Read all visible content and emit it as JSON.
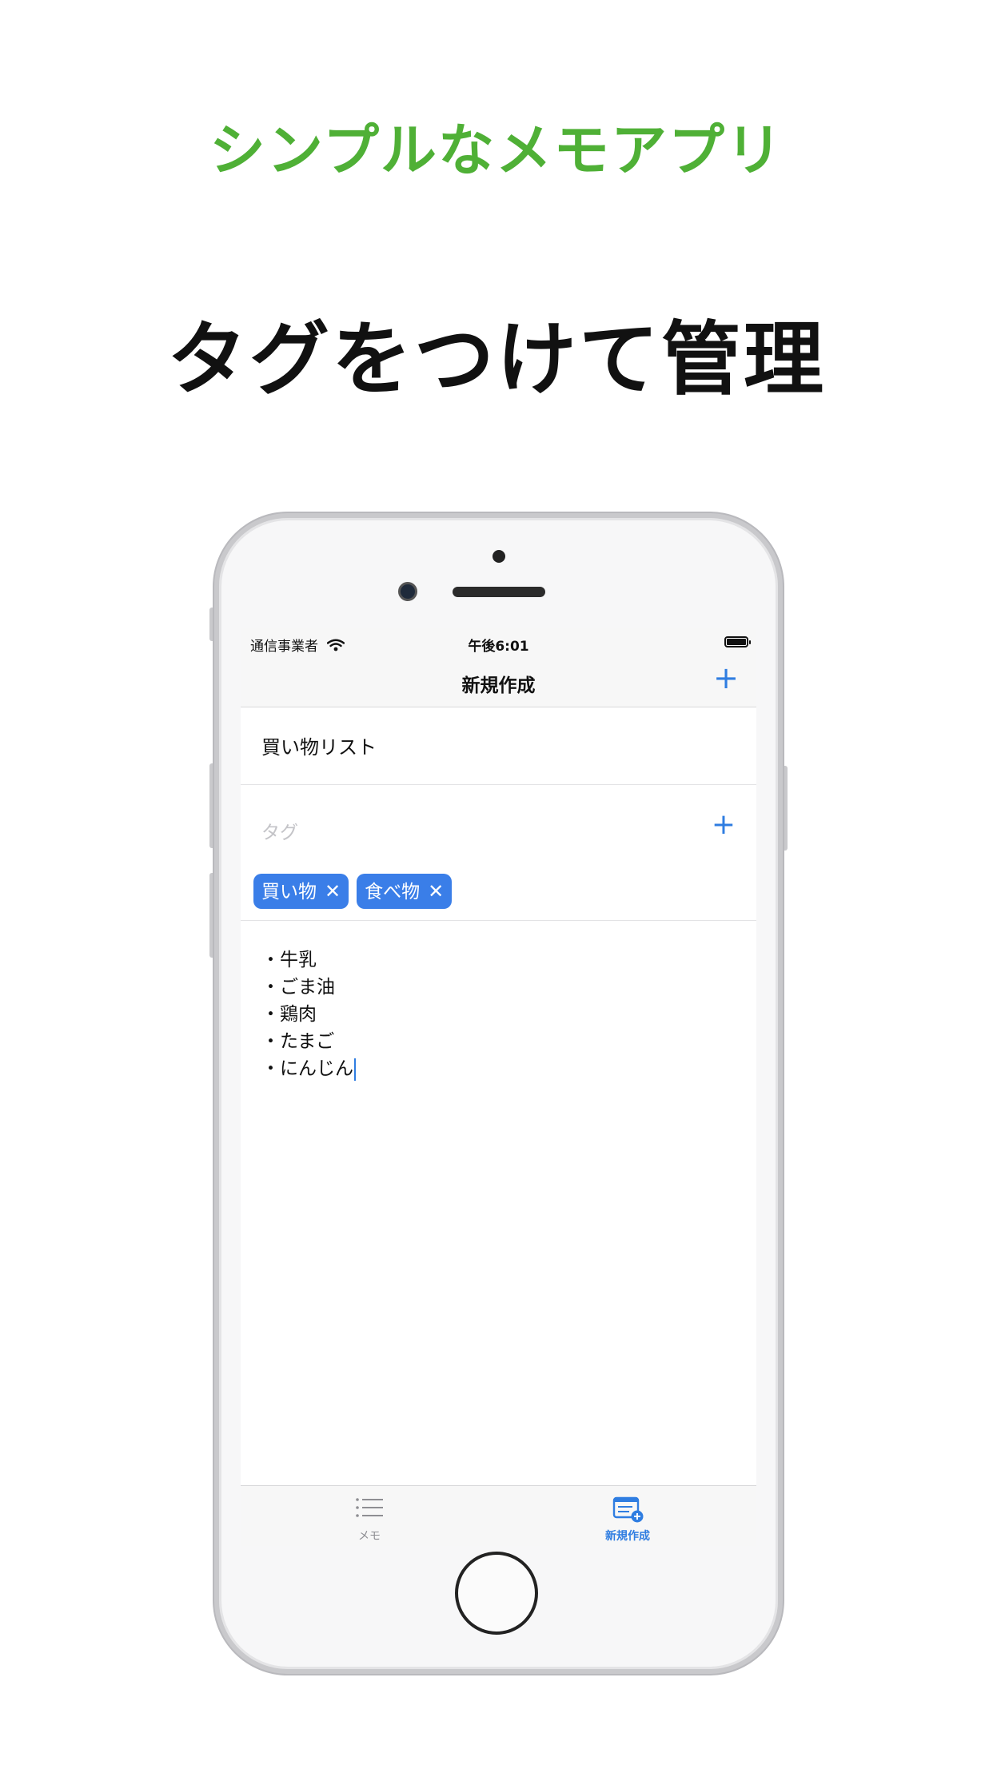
{
  "promo": {
    "subtitle": "シンプルなメモアプリ",
    "title": "タグをつけて管理"
  },
  "colors": {
    "subtitle": "#4fb036",
    "accent": "#2f7de1",
    "chip": "#3a7ee8"
  },
  "statusbar": {
    "carrier": "通信事業者",
    "time": "午後6:01"
  },
  "navbar": {
    "title": "新規作成",
    "action_icon": "plus-icon"
  },
  "memo": {
    "title": "買い物リスト",
    "tag_placeholder": "タグ",
    "tags": [
      {
        "label": "買い物"
      },
      {
        "label": "食べ物"
      }
    ],
    "lines": [
      "・牛乳",
      "・ごま油",
      "・鶏肉",
      "・たまご",
      "・にんじん"
    ]
  },
  "tabbar": {
    "items": [
      {
        "label": "メモ",
        "icon": "list-icon",
        "selected": false
      },
      {
        "label": "新規作成",
        "icon": "new-note-icon",
        "selected": true
      }
    ]
  }
}
